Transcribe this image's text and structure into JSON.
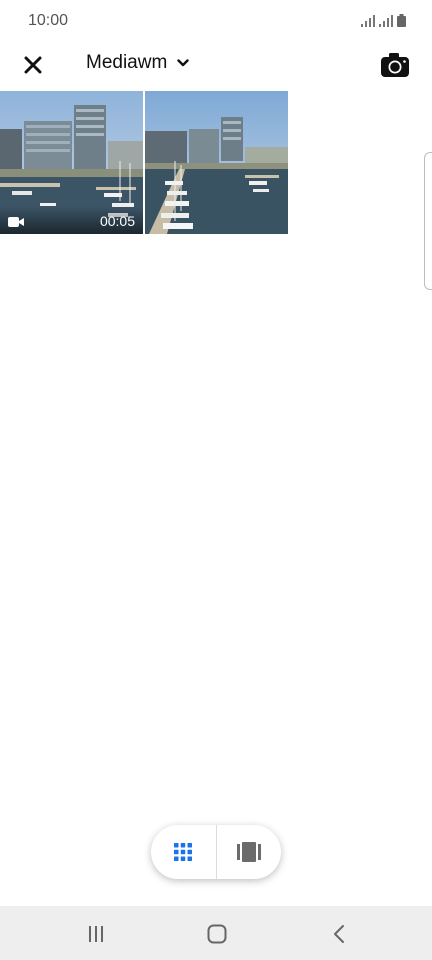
{
  "status_bar": {
    "time": "10:00",
    "icons": [
      "signal-icon",
      "signal-icon",
      "battery-icon"
    ]
  },
  "header": {
    "close_icon": "close-icon",
    "album_title": "Mediawm",
    "dropdown_icon": "chevron-down-icon",
    "camera_icon": "camera-icon"
  },
  "media": [
    {
      "type": "video",
      "duration": "00:05"
    },
    {
      "type": "photo"
    }
  ],
  "view_toggle": {
    "grid_icon": "grid-view-icon",
    "grid_active_color": "#1a73e8",
    "pages_icon": "page-view-icon",
    "pages_color": "#6b6b6b"
  },
  "nav_bar": {
    "recents_icon": "recents-icon",
    "home_icon": "home-icon",
    "back_icon": "back-icon"
  }
}
